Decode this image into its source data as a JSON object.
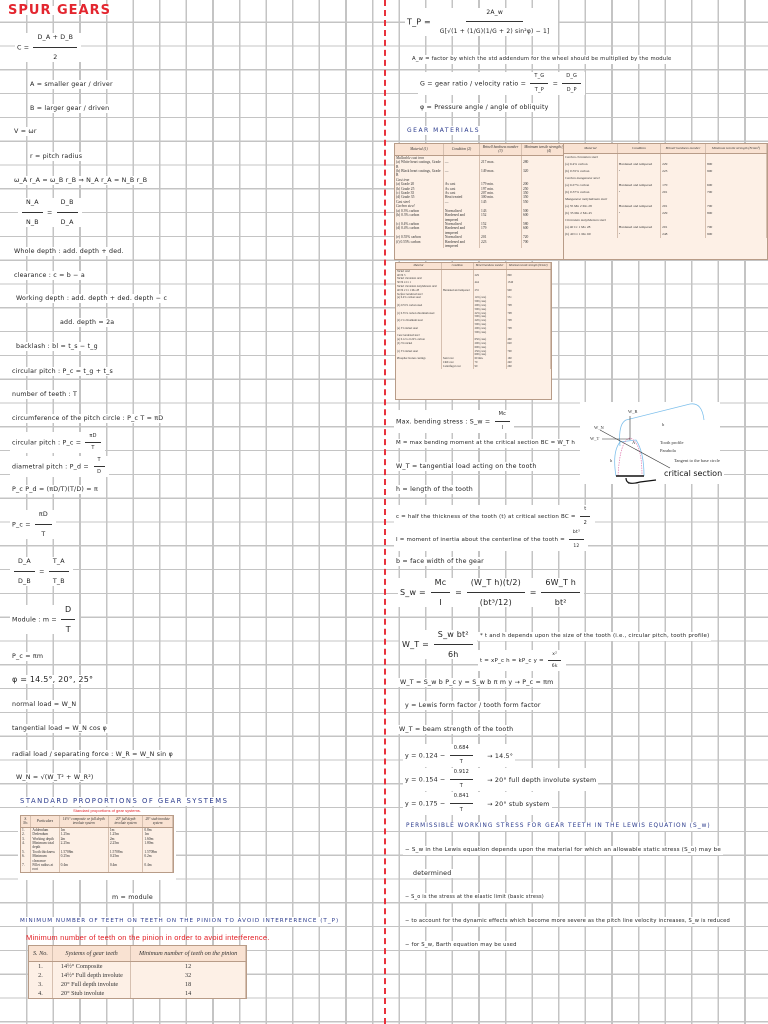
{
  "left": {
    "title": "SPUR GEARS",
    "c_lhs": "C =",
    "c_num": "D_A + D_B",
    "c_den": "2",
    "a_def": "A = smaller gear / driver",
    "b_def": "B = larger gear / driven",
    "v": "V = ωr",
    "r_def": "r = pitch radius",
    "omega": "ω_A r_A = ω_B r_B  ⇒  N_A r_A = N_B r_B",
    "ratio_n1": "N_A",
    "ratio_d1": "N_B",
    "ratio_eq": "=",
    "ratio_n2": "D_B",
    "ratio_d2": "D_A",
    "whole_depth": "Whole depth : add. depth + ded.",
    "clearance": "clearance : c = b − a",
    "working_depth": "Working depth : add. depth + ded. depth − c",
    "add_depth": "add. depth = 2a",
    "backlash": "backlash : bl = t_s − t_g",
    "circ_pitch1": "circular pitch : P_c = t_g + t_s",
    "num_teeth": "number of teeth : T",
    "circumference": "circumference of the pitch circle : P_c T = πD",
    "circ_pitch2_lhs": "circular pitch : P_c =",
    "circ_pitch2_n": "πD",
    "circ_pitch2_d": "T",
    "diam_pitch_lhs": "diametral pitch : P_d =",
    "diam_pitch_n": "T",
    "diam_pitch_d": "D",
    "pcpd": "P_c P_d = (πD/T)(T/D) = π",
    "pc_lhs": "P_c =",
    "pc_n": "πD",
    "pc_d": "T",
    "da_n": "D_A",
    "da_d": "D_B",
    "ta_eq": "=",
    "ta_n": "T_A",
    "ta_d": "T_B",
    "module_lhs": "Module : m =",
    "module_n": "D",
    "module_d": "T",
    "pc_pim": "P_c = πm",
    "phi": "φ = 14.5°, 20°, 25°",
    "normal_load": "normal load = W_N",
    "tangential_load": "tangential load = W_N cos φ",
    "radial_load": "radial load / separating force : W_R = W_N sin φ",
    "wn": "W_N = √(W_T² + W_R²)",
    "std_heading": "STANDARD PROPORTIONS OF GEAR SYSTEMS",
    "m_module": "m = module",
    "min_heading": "MINIMUM NUMBER OF TEETH ON TEETH ON THE PINION TO AVOID INTERFERENCE (T_P)",
    "min_caption": "Minimum number of teeth on the pinion in order to avoid interference."
  },
  "std_table": {
    "caption": "Standard proportions of gear systems.",
    "headers": [
      "S. No.",
      "Particulars",
      "14½° composite or full depth involute system",
      "20° full depth involute system",
      "20° stub involute system"
    ],
    "rows": [
      [
        "1.",
        "Addendum",
        "1m",
        "1m",
        "0.8m"
      ],
      [
        "2.",
        "Dedendum",
        "1.25m",
        "1.25m",
        "1m"
      ],
      [
        "3.",
        "Working depth",
        "2m",
        "2m",
        "1.60m"
      ],
      [
        "4.",
        "Minimum total depth",
        "2.25m",
        "2.25m",
        "1.80m"
      ],
      [
        "5.",
        "Tooth thickness",
        "1.5708m",
        "1.5708m",
        "1.5708m"
      ],
      [
        "6.",
        "Minimum clearance",
        "0.25m",
        "0.25m",
        "0.2m"
      ],
      [
        "7.",
        "Fillet radius at root",
        "0.4m",
        "0.4m",
        "0.4m"
      ]
    ]
  },
  "min_table": {
    "headers": [
      "S. No.",
      "Systems of gear teeth",
      "Minimum number of teeth on the pinion"
    ],
    "rows": [
      [
        "1.",
        "14½° Composite",
        "12"
      ],
      [
        "2.",
        "14½° Full depth involute",
        "32"
      ],
      [
        "3.",
        "20° Full depth involute",
        "18"
      ],
      [
        "4.",
        "20° Stub involute",
        "14"
      ]
    ]
  },
  "right": {
    "tp_lhs": "T_P =",
    "tp_n": "2A_w",
    "tp_d": "G[√(1 + (1/G)(1/G + 2) sin²φ) − 1]",
    "aw": "A_w = factor by which the std addendum for the wheel should be multiplied by the module",
    "g_lhs": "G = gear ratio / velocity ratio =",
    "g_n1": "T_G",
    "g_d1": "T_P",
    "g_eq": "=",
    "g_n2": "D_G",
    "g_d2": "D_P",
    "phi_def": "φ = Pressure angle / angle of obliquity",
    "materials_heading": "GEAR MATERIALS",
    "max_bending_lhs": "Max. bending stress : S_w =",
    "max_bending_n": "Mc",
    "max_bending_d": "I",
    "m_def": "M = max bending moment at the critical section BC = W_T h",
    "wt_def": "W_T = tangential load acting on the tooth",
    "h_def": "h = length of the tooth",
    "c_def_lhs": "c = half the thickness of the tooth (t) at critical section BC =",
    "c_def_n": "t",
    "c_def_d": "2",
    "i_def_lhs": "I = moment of inertia about the centerline of the tooth =",
    "i_def_n": "bt³",
    "i_def_d": "12",
    "b_def": "b = face width of the gear",
    "sw_lhs": "S_w =",
    "sw_n1": "Mc",
    "sw_d1": "I",
    "sw_eq1": "=",
    "sw_n2": "(W_T h)(t/2)",
    "sw_d2": "(bt³/12)",
    "sw_eq2": "=",
    "sw_n3": "6W_T h",
    "sw_d3": "bt²",
    "wt_lhs": "W_T =",
    "wt_n": "S_w bt²",
    "wt_d": "6h",
    "wt_note": "* t and h depends upon the size of the tooth (i.e., circular pitch, tooth profile)",
    "t_eq": "t = xP_c     h = kP_c     y =",
    "y_n": "x²",
    "y_d": "6k",
    "wt_lewis": "W_T = S_w b P_c y = S_w b π m y  →  P_c = πm",
    "y_def": "y = Lewis form factor / tooth form factor",
    "wt_beam": "W_T = beam strength of the tooth",
    "y1_lhs": "y = 0.124 −",
    "y1_n": "0.684",
    "y1_d": "T",
    "y1_note": "→ 14.5°",
    "y2_lhs": "y = 0.154 −",
    "y2_n": "0.912",
    "y2_d": "T",
    "y2_note": "→ 20° full depth involute system",
    "y3_lhs": "y = 0.175 −",
    "y3_n": "0.841",
    "y3_d": "T",
    "y3_note": "→ 20° stub system",
    "perm_heading": "PERMISSIBLE WORKING STRESS FOR GEAR TEETH IN THE LEWIS EQUATION (S_w)",
    "perm1": "− S_w in the Lewis equation depends upon the material for which an allowable static stress (S_o) may be",
    "perm1b": "determined",
    "perm2": "− S_o is the stress at the elastic limit (basic stress)",
    "perm3": "− to account for the dynamic effects which become more severe as the pitch line velocity increases, S_w is reduced",
    "perm4": "− for S_w, Barth equation may be used"
  },
  "diagram": {
    "wr": "W_R",
    "wn": "W_N",
    "wt": "W_T",
    "a": "A",
    "b": "b",
    "h": "h",
    "t": "t",
    "tooth_profile": "Tooth profile",
    "parabola": "Parabola",
    "tangent": "Tangent to the base circle",
    "critical": "critical section"
  },
  "mat_table1": {
    "headers": [
      "Material (1)",
      "Condition (2)",
      "Brinell hardness number (3)",
      "Minimum tensile strength (N/mm²) (4)"
    ],
    "rows": [
      [
        "Malleable cast iron",
        "",
        "",
        ""
      ],
      [
        "(a) White heart castings, Grade B",
        "—",
        "217 max.",
        "280"
      ],
      [
        "(b) Black heart castings, Grade B",
        "—",
        "149 max.",
        "320"
      ],
      [
        "Cast iron",
        "",
        "",
        ""
      ],
      [
        "(a) Grade 20",
        "As cast",
        "179 min.",
        "200"
      ],
      [
        "(b) Grade 25",
        "As cast",
        "197 min.",
        "250"
      ],
      [
        "(c) Grade 35",
        "As cast",
        "207 min.",
        "350"
      ],
      [
        "(d) Grade 35",
        "Heat treated",
        "300 min.",
        "350"
      ],
      [
        "Cast steel",
        "—",
        "145",
        "550"
      ],
      [
        "Carbon steel",
        "",
        "",
        ""
      ],
      [
        "(a) 0.3% carbon",
        "Normalised",
        "143",
        "500"
      ],
      [
        "(b) 0.3% carbon",
        "Hardened and tempered",
        "152",
        "600"
      ],
      [
        "(c) 0.4% carbon",
        "Normalised",
        "152",
        "580"
      ],
      [
        "(d) 0.4% carbon",
        "Hardened and tempered",
        "179",
        "600"
      ],
      [
        "(e) 0.55% carbon",
        "Normalised",
        "201",
        "720"
      ],
      [
        "(f) 0.55% carbon",
        "Hardened and tempered",
        "223",
        "700"
      ]
    ]
  },
  "mat_table2": {
    "headers": [
      "Material",
      "Condition",
      "Brinell hardness number",
      "Minimum tensile strength (N/mm²)"
    ],
    "rows": [
      [
        "Carbon chromium steel",
        "",
        "",
        ""
      ],
      [
        "(a) 0.4% carbon",
        "Hardened and tempered",
        "229",
        "800"
      ],
      [
        "(b) 0.55% carbon",
        "\"",
        "223",
        "900"
      ],
      [
        "Carbon manganese steel",
        "",
        "",
        ""
      ],
      [
        "(a) 0.27% carbon",
        "Hardened and tempered",
        "170",
        "600"
      ],
      [
        "(b) 0.37% carbon",
        "\"",
        "201",
        "700"
      ],
      [
        "Manganese molybdenum steel",
        "",
        "",
        ""
      ],
      [
        "(a) 35 Mn 2 Mo 28",
        "Hardened and tempered",
        "201",
        "700"
      ],
      [
        "(b) 35 Mn 2 Mo 45",
        "\"",
        "229",
        "800"
      ],
      [
        "Chromium molybdenum steel",
        "",
        "",
        ""
      ],
      [
        "(a) 40 Cr 1 Mo 28",
        "Hardened and tempered",
        "201",
        "700"
      ],
      [
        "(b) 40 Cr 1 Mo 60",
        "\"",
        "248",
        "900"
      ]
    ]
  },
  "mat_table3": {
    "headers": [
      "Material",
      "Condition",
      "Brinell hardness number",
      "Minimum tensile strength (N/mm²)"
    ],
    "rows": [
      [
        "Nickel steel",
        "",
        "",
        ""
      ],
      [
        "40 Ni 3",
        "",
        "229",
        "800"
      ],
      [
        "Nickel chromium steel",
        "",
        "",
        ""
      ],
      [
        "30 Ni 4 Cr 1",
        "",
        "444",
        "1540"
      ],
      [
        "Nickel chromium molybdenum steel",
        "",
        "",
        ""
      ],
      [
        "40 Ni 2 Cr 1 Mo 28",
        "Hardened and tempered",
        "255",
        "900"
      ],
      [
        "Surface hardened steel",
        "",
        "",
        ""
      ],
      [
        "(a) 0.4% carbon steel",
        "",
        "145 (core)",
        "551"
      ],
      [
        "",
        "",
        "500 (case)",
        ""
      ],
      [
        "(b) 0.55% carbon steel",
        "",
        "200 (core)",
        "708"
      ],
      [
        "",
        "",
        "500 (case)",
        ""
      ],
      [
        "(c) 0.55% carbon chromium steel",
        "",
        "225 (core)",
        "708"
      ],
      [
        "",
        "",
        "500 (case)",
        ""
      ],
      [
        "(d) 1% chromium steel",
        "",
        "220 (core)",
        "708"
      ],
      [
        "",
        "",
        "500 (case)",
        ""
      ],
      [
        "(e) 3% nickel steel",
        "",
        "200 (core)",
        "708"
      ],
      [
        "",
        "",
        "500 (case)",
        ""
      ],
      [
        "Case hardened steel",
        "",
        "",
        ""
      ],
      [
        "(a) 0.12 to 0.22% carbon",
        "",
        "650 (case)",
        "460"
      ],
      [
        "(b) 3% nickel",
        "",
        "200 (core)",
        "620"
      ],
      [
        "",
        "",
        "600 (case)",
        ""
      ],
      [
        "(c) 5% nickel steel",
        "",
        "250 (core)",
        "700"
      ],
      [
        "",
        "",
        "600 (case)",
        ""
      ],
      [
        "Phosphor bronze castings",
        "Sand cast",
        "60 min.",
        "160"
      ],
      [
        "",
        "Chill cast",
        "70",
        "240"
      ],
      [
        "",
        "Centrifugal cast",
        "90",
        "260"
      ]
    ]
  }
}
